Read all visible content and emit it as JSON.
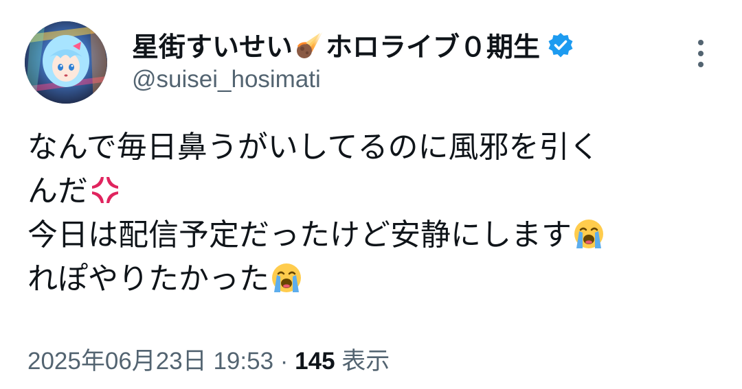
{
  "author": {
    "display_name": "星街すいせい",
    "display_name_suffix": "ホロライブ０期生",
    "name_emoji_icon": "comet-icon",
    "verified_icon": "verified-badge-icon",
    "handle": "@suisei_hosimati",
    "avatar_icon": "avatar-image"
  },
  "more_icon": "more-options-icon",
  "tweet": {
    "lines": [
      {
        "text": "なんで毎日鼻うがいしてるのに風邪を引く",
        "emoji": ""
      },
      {
        "text": "んだ",
        "emoji": "anger-symbol-icon"
      },
      {
        "text": "今日は配信予定だったけど安静にします",
        "emoji": "loudly-crying-face-icon"
      },
      {
        "text": "れぽやりたかった",
        "emoji": "loudly-crying-face-icon"
      }
    ]
  },
  "meta": {
    "timestamp": "2025年06月23日 19:53",
    "separator": " · ",
    "views_count": "145",
    "views_label": " 表示"
  },
  "colors": {
    "text_primary": "#0f1419",
    "text_secondary": "#536471",
    "verified_blue": "#1d9bf0",
    "anger_red": "#e0245e"
  }
}
